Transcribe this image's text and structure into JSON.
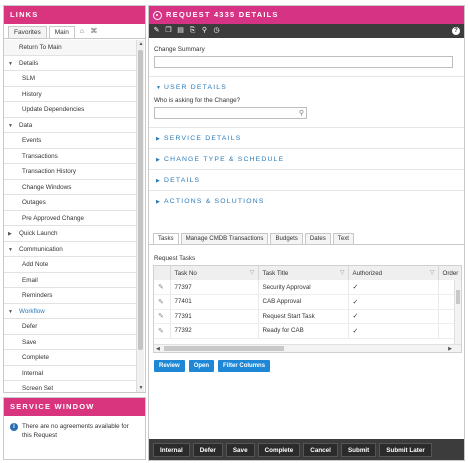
{
  "links_panel": {
    "title": "LINKS",
    "tabs": [
      "Favorites",
      "Main"
    ],
    "icons": [
      "home-icon",
      "sitemap-icon"
    ],
    "items": [
      {
        "label": "Return To Main",
        "level": 1,
        "expandable": false,
        "selected": true
      },
      {
        "label": "Details",
        "level": 0,
        "expandable": true,
        "expanded": true
      },
      {
        "label": "SLM",
        "level": 1
      },
      {
        "label": "History",
        "level": 1
      },
      {
        "label": "Update Dependencies",
        "level": 1
      },
      {
        "label": "Data",
        "level": 0,
        "expandable": true,
        "expanded": true
      },
      {
        "label": "Events",
        "level": 1
      },
      {
        "label": "Transactions",
        "level": 1
      },
      {
        "label": "Transaction History",
        "level": 1
      },
      {
        "label": "Change Windows",
        "level": 1
      },
      {
        "label": "Outages",
        "level": 1
      },
      {
        "label": "Pre Approved Change",
        "level": 1
      },
      {
        "label": "Quick Launch",
        "level": 0,
        "expandable": true,
        "expanded": false
      },
      {
        "label": "Communication",
        "level": 0,
        "expandable": true,
        "expanded": true
      },
      {
        "label": "Add Note",
        "level": 1
      },
      {
        "label": "Email",
        "level": 1
      },
      {
        "label": "Reminders",
        "level": 1
      },
      {
        "label": "Workflow",
        "level": 0,
        "expandable": true,
        "expanded": true,
        "active": true
      },
      {
        "label": "Defer",
        "level": 1
      },
      {
        "label": "Save",
        "level": 1
      },
      {
        "label": "Complete",
        "level": 1
      },
      {
        "label": "Internal",
        "level": 1
      },
      {
        "label": "Screen Set",
        "level": 1
      }
    ]
  },
  "service_window": {
    "title": "SERVICE WINDOW",
    "message": "There are no agreements available for this Request"
  },
  "details": {
    "title": "REQUEST 4335 DETAILS",
    "toolbar_icons": [
      "pin-icon",
      "copy-icon",
      "print-icon",
      "attach-icon",
      "link-icon",
      "history-icon"
    ],
    "change_summary_label": "Change Summary",
    "change_summary_value": "",
    "sections": {
      "user_details": "USER DETAILS",
      "service_details": "SERVICE DETAILS",
      "change_type": "CHANGE TYPE & SCHEDULE",
      "details": "DETAILS",
      "actions": "ACTIONS & SOLUTIONS"
    },
    "who_label": "Who is asking for the Change?",
    "who_value": "",
    "tabs": [
      "Tasks",
      "Manage CMDB Transactions",
      "Budgets",
      "Dates",
      "Text"
    ],
    "active_tab": "Tasks",
    "request_tasks_label": "Request Tasks",
    "grid": {
      "columns": [
        "Task No",
        "Task Title",
        "Authorized",
        "Order"
      ],
      "rows": [
        {
          "task_no": "77397",
          "title": "Security Approval",
          "authorized": true
        },
        {
          "task_no": "77401",
          "title": "CAB Approval",
          "authorized": true
        },
        {
          "task_no": "77391",
          "title": "Request Start Task",
          "authorized": true
        },
        {
          "task_no": "77392",
          "title": "Ready for CAB",
          "authorized": true
        }
      ]
    },
    "grid_buttons": [
      "Review",
      "Open",
      "Filter Columns"
    ],
    "footer_buttons": [
      "Internal",
      "Defer",
      "Save",
      "Complete",
      "Cancel",
      "Submit",
      "Submit Later"
    ]
  },
  "colors": {
    "header_pink": "#d9357f",
    "link_blue": "#2a7ab8",
    "button_blue": "#1e88d6",
    "toolbar_dark": "#3c3c3c"
  }
}
